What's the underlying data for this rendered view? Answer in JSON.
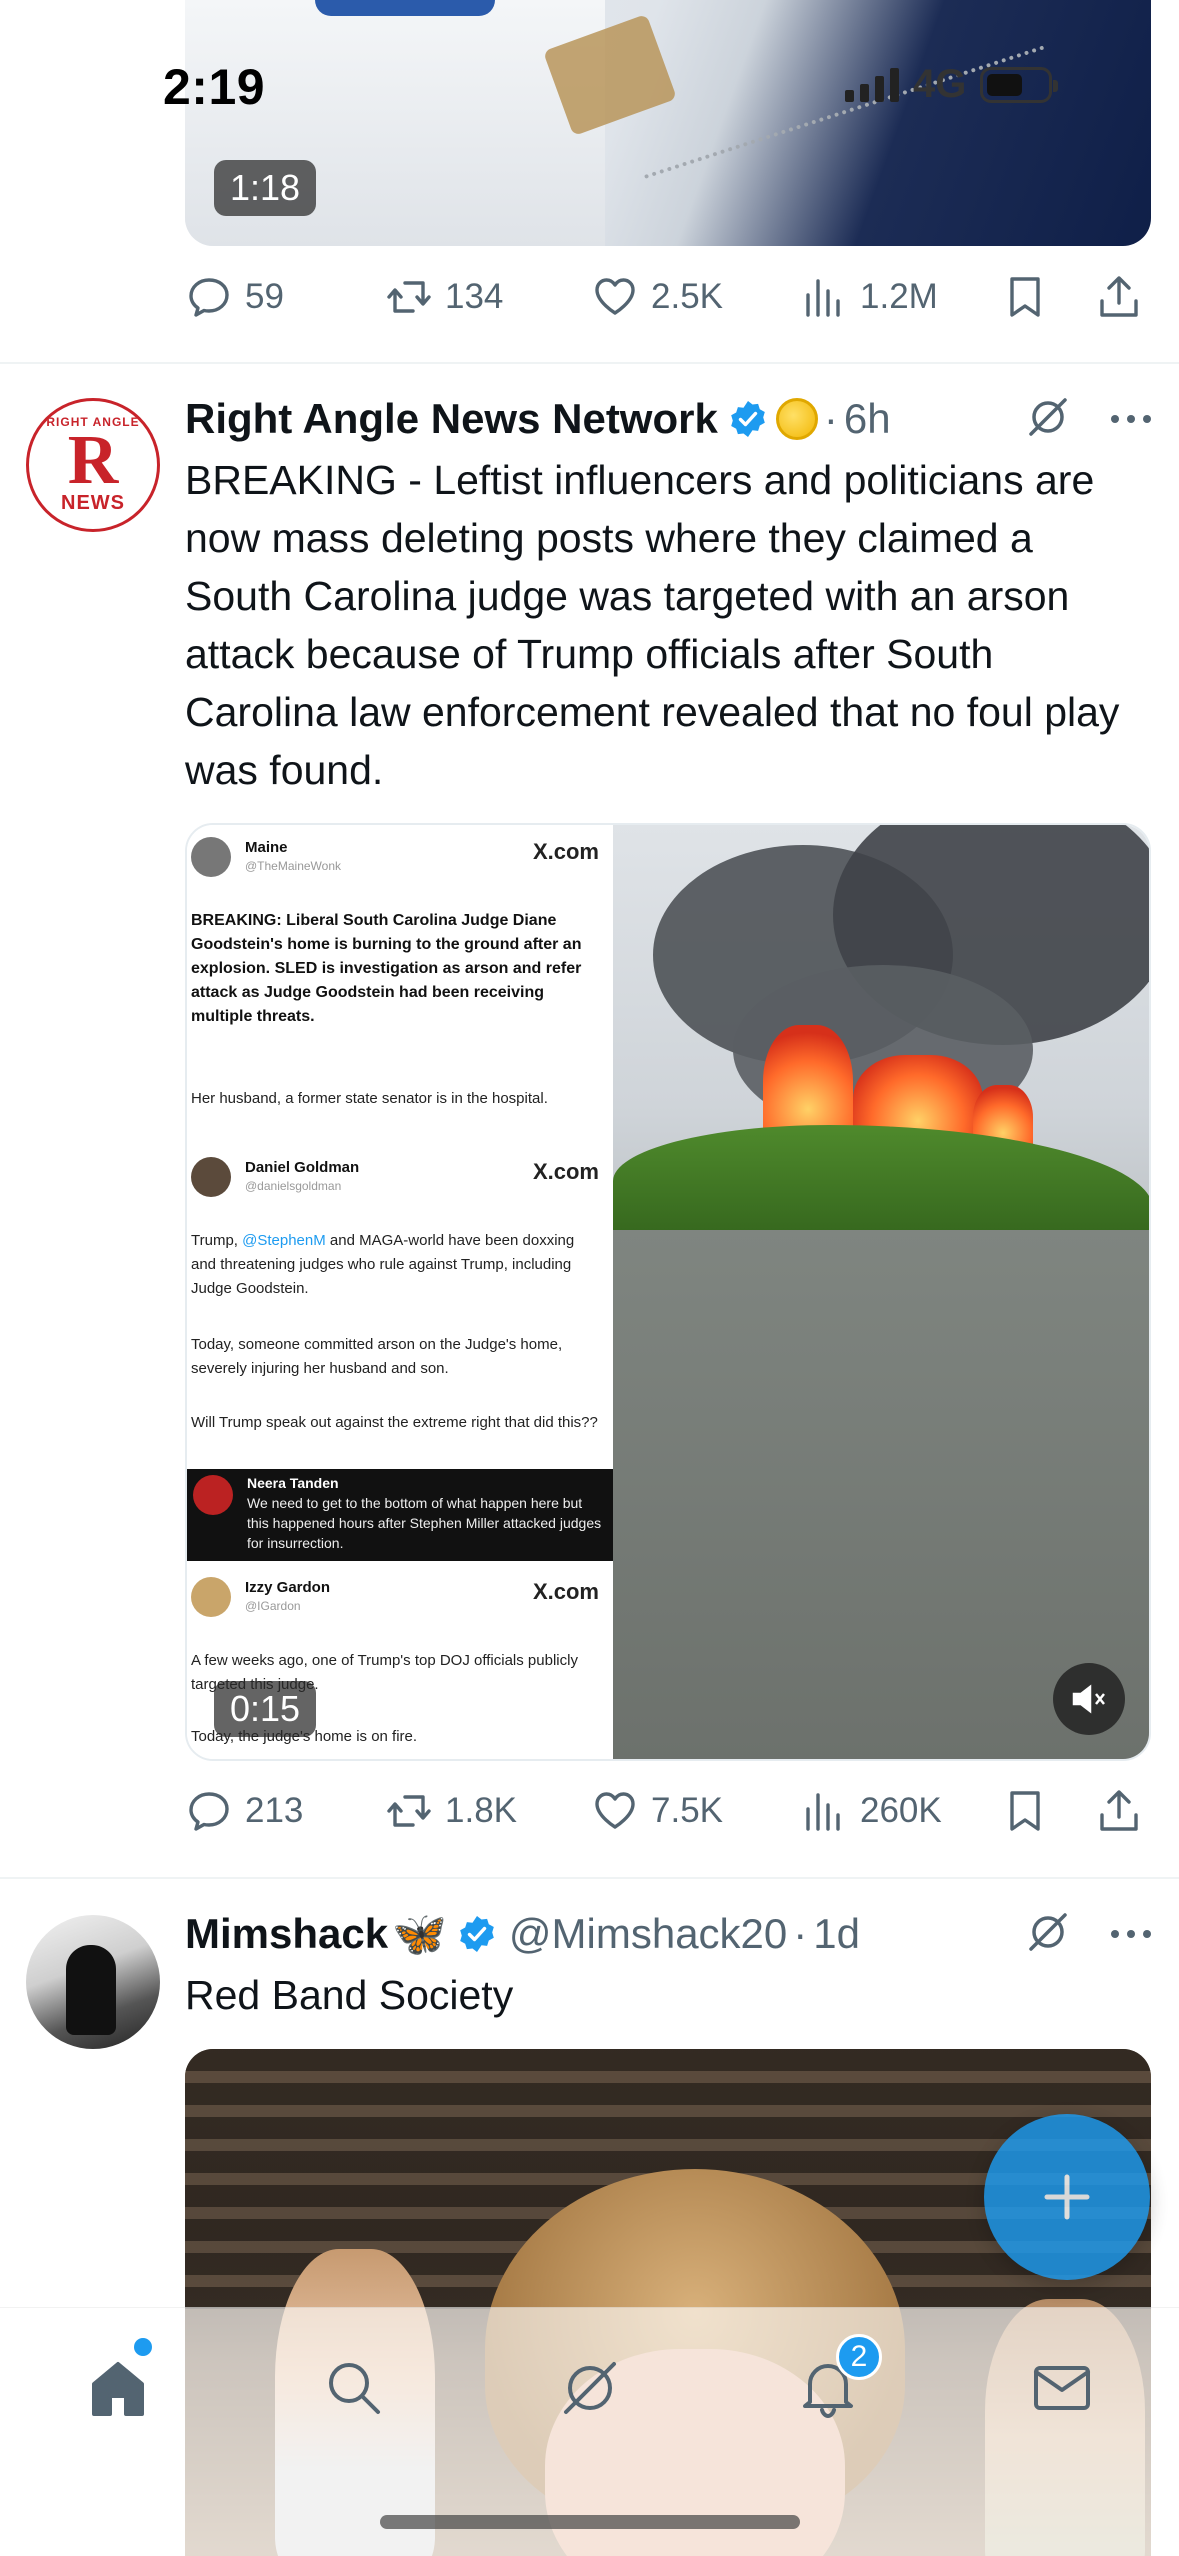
{
  "status_bar": {
    "time": "2:19",
    "network": "4G"
  },
  "top_post": {
    "video_duration": "1:18",
    "actions": {
      "replies": "59",
      "reposts": "134",
      "likes": "2.5K",
      "views": "1.2M"
    }
  },
  "post1": {
    "author_name": "Right Angle News Network",
    "time": "6h",
    "text": "BREAKING - Leftist influencers and politicians are now mass deleting posts where they claimed a South Carolina judge was targeted with an arson attack because of Trump officials after South Carolina law enforcement revealed that no foul play was found.",
    "avatar_text": {
      "top": "RIGHT ANGLE",
      "letter": "R",
      "bottom": "NEWS"
    },
    "video_duration": "0:15",
    "embedded": {
      "tweet1": {
        "name": "Maine",
        "handle": "@TheMaineWonk",
        "source": "X.com",
        "body_bold": "BREAKING: Liberal South Carolina Judge Diane Goodstein's home is burning to the ground after an explosion. SLED is investigation as arson and refer attack as Judge Goodstein had been receiving multiple threats.",
        "body": "Her husband, a former state senator is in the hospital."
      },
      "tweet2": {
        "name": "Daniel Goldman",
        "handle": "@danielsgoldman",
        "source": "X.com",
        "p1_pre": "Trump, ",
        "p1_link": "@StephenM",
        "p1_post": " and MAGA-world have been doxxing and threatening judges who rule against Trump, including Judge Goodstein.",
        "p2": "Today, someone committed arson on the Judge's home, severely injuring her husband and son.",
        "p3": "Will Trump speak out against the extreme right that did this??"
      },
      "tweet3": {
        "name": "Neera Tanden",
        "body": "We need to get to the bottom of what happen here but this happened hours after Stephen Miller attacked judges for insurrection."
      },
      "tweet4": {
        "name": "Izzy Gardon",
        "handle": "@IGardon",
        "source": "X.com",
        "p1": "A few weeks ago, one of Trump's top DOJ officials publicly targeted this judge.",
        "p2": "Today, the judge's home is on fire."
      }
    },
    "actions": {
      "replies": "213",
      "reposts": "1.8K",
      "likes": "7.5K",
      "views": "260K"
    }
  },
  "post2": {
    "author_name": "Mimshack",
    "name_emoji": "🦋",
    "handle": "@Mimshack20",
    "time": "1d",
    "text": "Red Band Society"
  },
  "bottom_nav": {
    "notification_count": "2"
  },
  "icons": {
    "reply": "reply-icon",
    "repost": "repost-icon",
    "like": "heart-icon",
    "views": "views-icon",
    "bookmark": "bookmark-icon",
    "share": "share-icon",
    "grok": "grok-icon",
    "more": "more-icon",
    "verified": "verified-badge-icon",
    "home": "home-icon",
    "search": "search-icon",
    "notifications": "bell-icon",
    "messages": "mail-icon",
    "compose": "plus-icon",
    "mute": "mute-icon"
  },
  "colors": {
    "accent": "#1d9bf0",
    "muted_text": "#536471",
    "text": "#0f1419"
  }
}
